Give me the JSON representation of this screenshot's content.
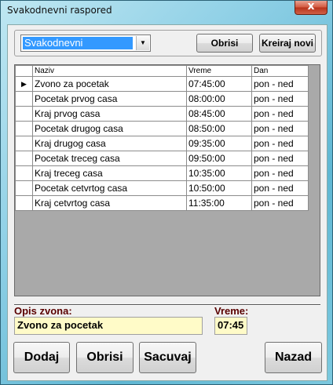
{
  "window": {
    "title": "Svakodnevni raspored",
    "close_glyph": "x"
  },
  "toolbar": {
    "schedule_select_value": "Svakodnevni",
    "delete_label": "Obrisi",
    "create_new_label": "Kreiraj novi"
  },
  "grid": {
    "columns": [
      "Naziv",
      "Vreme",
      "Dan"
    ],
    "current_row_marker": "▶",
    "rows": [
      {
        "naziv": "Zvono za pocetak",
        "vreme": "07:45:00",
        "dan": "pon - ned"
      },
      {
        "naziv": "Pocetak prvog casa",
        "vreme": "08:00:00",
        "dan": "pon - ned"
      },
      {
        "naziv": "Kraj prvog casa",
        "vreme": "08:45:00",
        "dan": "pon - ned"
      },
      {
        "naziv": "Pocetak drugog casa",
        "vreme": "08:50:00",
        "dan": "pon - ned"
      },
      {
        "naziv": "Kraj drugog casa",
        "vreme": "09:35:00",
        "dan": "pon - ned"
      },
      {
        "naziv": "Pocetak treceg casa",
        "vreme": "09:50:00",
        "dan": "pon - ned"
      },
      {
        "naziv": "Kraj treceg  casa",
        "vreme": "10:35:00",
        "dan": "pon - ned"
      },
      {
        "naziv": "Pocetak cetvrtog casa",
        "vreme": "10:50:00",
        "dan": "pon - ned"
      },
      {
        "naziv": "Kraj cetvrtog casa",
        "vreme": "11:35:00",
        "dan": "pon - ned"
      }
    ]
  },
  "form": {
    "opis_label": "Opis zvona:",
    "opis_value": "Zvono za pocetak",
    "vreme_label": "Vreme:",
    "vreme_value": "07:45"
  },
  "actions": {
    "add_label": "Dodaj",
    "delete_label": "Obrisi",
    "save_label": "Sacuvaj",
    "back_label": "Nazad"
  }
}
